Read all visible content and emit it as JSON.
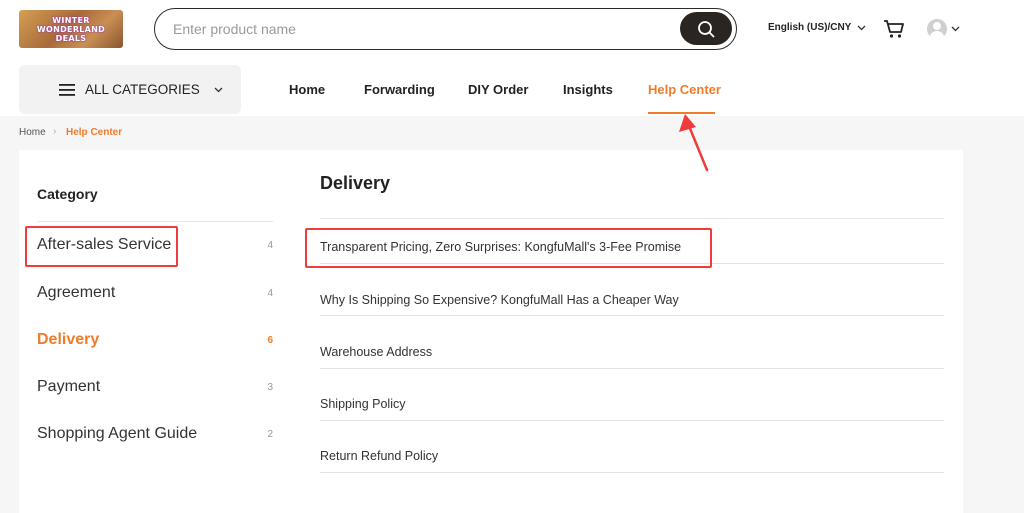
{
  "header": {
    "logo_text": "WINTER\nWONDERLAND\nDEALS",
    "search_placeholder": "Enter product name",
    "language": "English (US)/CNY",
    "icons": {
      "search": "search-icon",
      "cart": "cart-icon",
      "account": "avatar-icon"
    }
  },
  "nav": {
    "categories_label": "ALL CATEGORIES",
    "items": [
      {
        "label": "Home"
      },
      {
        "label": "Forwarding"
      },
      {
        "label": "DIY Order"
      },
      {
        "label": "Insights"
      },
      {
        "label": "Help Center",
        "active": true
      }
    ]
  },
  "breadcrumb": {
    "home": "Home",
    "current": "Help Center"
  },
  "sidebar": {
    "title": "Category",
    "items": [
      {
        "label": "After-sales Service",
        "count": "4"
      },
      {
        "label": "Agreement",
        "count": "4"
      },
      {
        "label": "Delivery",
        "count": "6",
        "active": true
      },
      {
        "label": "Payment",
        "count": "3"
      },
      {
        "label": "Shopping Agent Guide",
        "count": "2"
      }
    ]
  },
  "main": {
    "section_title": "Delivery",
    "articles": [
      {
        "title": "Transparent Pricing, Zero Surprises: KongfuMall's 3-Fee Promise"
      },
      {
        "title": "Why Is Shipping So Expensive? KongfuMall Has a Cheaper Way"
      },
      {
        "title": "Warehouse Address"
      },
      {
        "title": "Shipping Policy"
      },
      {
        "title": "Return Refund Policy"
      }
    ]
  },
  "colors": {
    "accent": "#f07c2a",
    "annotation": "#ee3b3b",
    "search_button": "#2a2520"
  }
}
